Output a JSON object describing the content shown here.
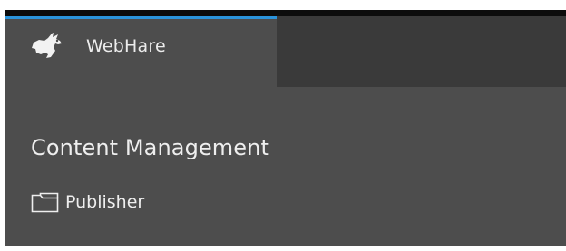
{
  "app": {
    "tab_label": "WebHare",
    "logo_icon": "rabbit-logo-icon",
    "accent_color": "#2b94dc"
  },
  "section": {
    "title": "Content Management",
    "items": [
      {
        "label": "Publisher",
        "icon": "folder-icon"
      }
    ]
  }
}
